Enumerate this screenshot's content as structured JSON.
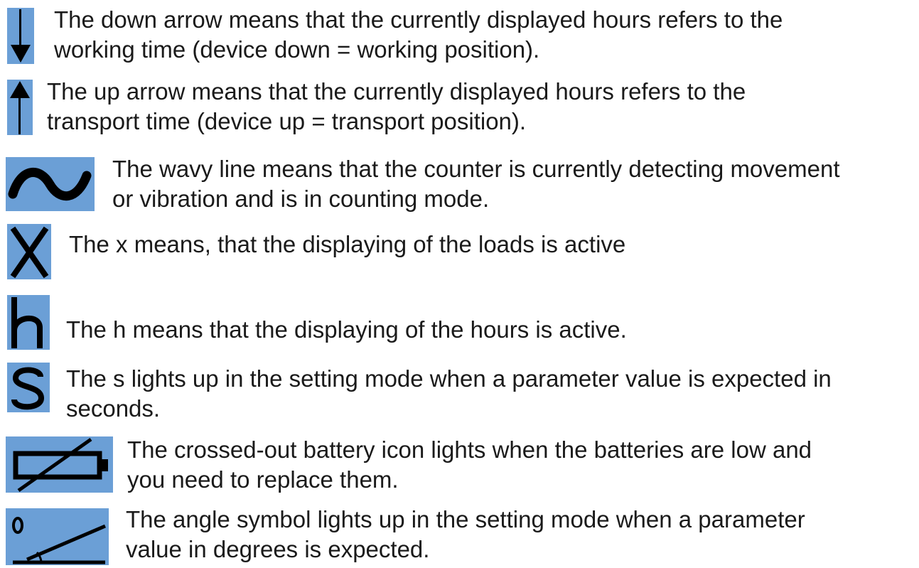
{
  "colors": {
    "icon_background": "#6b9fd6",
    "icon_foreground": "#000000",
    "text": "#1a1a1a"
  },
  "legend": [
    {
      "icon": "arrow-down-icon",
      "lines": [
        "The down arrow means that the currently displayed hours refers to the",
        "working time (device down = working position)."
      ]
    },
    {
      "icon": "arrow-up-icon",
      "lines": [
        "The up arrow means that the currently displayed hours refers to the",
        "transport time (device up = transport position)."
      ]
    },
    {
      "icon": "wavy-line-icon",
      "lines": [
        "The wavy line means that the counter is currently detecting movement",
        "or vibration and is in counting mode."
      ]
    },
    {
      "icon": "x-icon",
      "lines": [
        "The x means, that the displaying of the loads is active"
      ]
    },
    {
      "icon": "h-icon",
      "lines": [
        "The h means that the displaying of the hours is active."
      ]
    },
    {
      "icon": "s-icon",
      "lines": [
        "The s lights up in the setting mode when a parameter value is expected in",
        "seconds."
      ]
    },
    {
      "icon": "crossed-battery-icon",
      "lines": [
        "The crossed-out battery icon lights when the batteries are low and",
        "you need to replace them."
      ]
    },
    {
      "icon": "angle-icon",
      "lines": [
        "The angle symbol lights up in the setting mode when a parameter",
        "value in degrees is expected."
      ]
    }
  ]
}
